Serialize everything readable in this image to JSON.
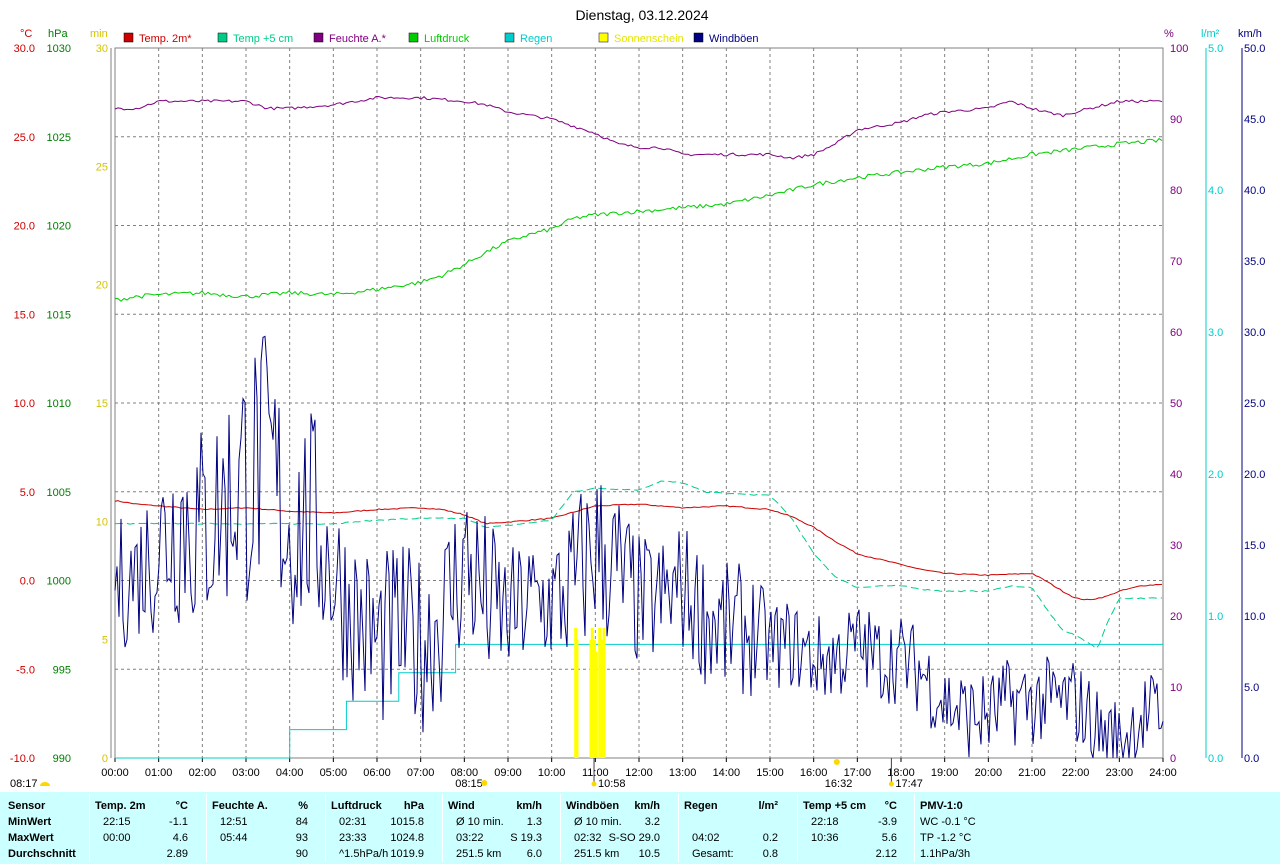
{
  "chart_data": {
    "type": "line",
    "title": "Dienstag, 03.12.2024",
    "x_ticks": [
      "00:00",
      "01:00",
      "02:00",
      "03:00",
      "04:00",
      "05:00",
      "06:00",
      "07:00",
      "08:00",
      "09:00",
      "10:00",
      "11:00",
      "12:00",
      "13:00",
      "14:00",
      "15:00",
      "16:00",
      "17:00",
      "18:00",
      "19:00",
      "20:00",
      "21:00",
      "22:00",
      "23:00",
      "24:00"
    ],
    "x_range_hours": [
      0,
      24
    ],
    "grid": true,
    "legend_position": "top",
    "axes": {
      "temp": {
        "unit": "°C",
        "range": [
          -10,
          30
        ],
        "ticks": [
          "-10.0",
          "-5.0",
          "0.0",
          "5.0",
          "10.0",
          "15.0",
          "20.0",
          "25.0",
          "30.0"
        ],
        "color": "#cc0000"
      },
      "pressure": {
        "unit": "hPa",
        "range": [
          990,
          1030
        ],
        "ticks": [
          "990",
          "995",
          "1000",
          "1005",
          "1010",
          "1015",
          "1020",
          "1025",
          "1030"
        ],
        "color": "#008000"
      },
      "sun": {
        "unit": "min",
        "range": [
          0,
          30
        ],
        "ticks": [
          "0",
          "5",
          "10",
          "15",
          "20",
          "25",
          "30"
        ],
        "color": "#e6e600"
      },
      "humidity": {
        "unit": "%",
        "range": [
          0,
          100
        ],
        "ticks": [
          "0",
          "10",
          "20",
          "30",
          "40",
          "50",
          "60",
          "70",
          "80",
          "90",
          "100"
        ],
        "color": "#800080"
      },
      "rain": {
        "unit": "l/m²",
        "range": [
          0,
          5
        ],
        "ticks": [
          "0.0",
          "1.0",
          "2.0",
          "3.0",
          "4.0",
          "5.0"
        ],
        "color": "#00cccc"
      },
      "wind": {
        "unit": "km/h",
        "range": [
          0,
          50
        ],
        "ticks": [
          "0.0",
          "5.0",
          "10.0",
          "15.0",
          "20.0",
          "25.0",
          "30.0",
          "35.0",
          "40.0",
          "45.0",
          "50.0"
        ],
        "color": "#000080"
      }
    },
    "series": [
      {
        "name": "Temp. 2m*",
        "axis": "temp",
        "color": "#cc0000",
        "style": "solid",
        "x": [
          0,
          0.5,
          1,
          2,
          3,
          4,
          5,
          6,
          7,
          7.5,
          8,
          8.5,
          9,
          10,
          11,
          12,
          13,
          14,
          15,
          15.5,
          16,
          16.5,
          17,
          17.5,
          18,
          18.5,
          19,
          20,
          21,
          21.3,
          21.7,
          22,
          22.3,
          22.7,
          23,
          23.5,
          24
        ],
        "y": [
          4.5,
          4.3,
          4.2,
          4.0,
          4.1,
          3.9,
          3.8,
          4.0,
          4.1,
          4.0,
          3.7,
          3.2,
          3.3,
          3.5,
          4.2,
          4.3,
          4.1,
          4.2,
          4.0,
          3.6,
          3.0,
          2.2,
          1.5,
          1.2,
          0.9,
          0.6,
          0.4,
          0.3,
          0.4,
          0.0,
          -0.6,
          -1.0,
          -1.1,
          -0.9,
          -0.6,
          -0.3,
          -0.2
        ]
      },
      {
        "name": "Temp +5 cm",
        "axis": "temp",
        "color": "#00cc88",
        "style": "dashed",
        "x": [
          0,
          1,
          2,
          3,
          4,
          5,
          6,
          7,
          8,
          8.5,
          9,
          10,
          10.5,
          11,
          12,
          12.5,
          13,
          13.5,
          14,
          15,
          15.5,
          16,
          16.5,
          17,
          17.5,
          18,
          18.5,
          19,
          20,
          20.5,
          21,
          21.3,
          21.7,
          22,
          22.3,
          22.5,
          22.7,
          23,
          24
        ],
        "y": [
          3.2,
          3.2,
          3.2,
          3.2,
          3.2,
          3.2,
          3.4,
          3.5,
          3.5,
          3.0,
          3.1,
          3.4,
          5.0,
          5.2,
          5.1,
          5.6,
          5.5,
          5.0,
          4.9,
          4.8,
          3.5,
          1.5,
          0.2,
          -0.4,
          -0.3,
          -0.3,
          -0.5,
          -0.6,
          -0.6,
          -0.3,
          -0.4,
          -1.5,
          -2.8,
          -3.1,
          -3.5,
          -3.9,
          -2.5,
          -1.0,
          -1.0
        ]
      },
      {
        "name": "Feuchte A.*",
        "axis": "humidity",
        "color": "#800080",
        "style": "solid",
        "x": [
          0,
          0.5,
          1,
          2,
          3,
          3.5,
          4,
          5,
          6,
          7,
          8,
          8.5,
          9,
          10,
          11,
          11.5,
          12,
          12.5,
          13,
          14,
          15,
          15.5,
          16,
          16.5,
          17,
          17.5,
          18,
          18.5,
          19,
          20,
          20.5,
          21,
          21.3,
          21.7,
          22,
          23,
          24
        ],
        "y": [
          91.5,
          91.5,
          92.5,
          92.5,
          92.5,
          91.5,
          91.5,
          92.0,
          93.0,
          93.0,
          92.5,
          92.0,
          91.0,
          90.0,
          88.0,
          86.5,
          86.0,
          86.0,
          85.0,
          85.0,
          85.0,
          84.5,
          85.0,
          86.5,
          88.5,
          89.0,
          89.5,
          90.5,
          91.0,
          91.5,
          92.5,
          91.5,
          91.0,
          90.5,
          91.0,
          92.5,
          92.5
        ]
      },
      {
        "name": "Luftdruck",
        "axis": "pressure",
        "color": "#00cc00",
        "style": "solid",
        "x": [
          0,
          0.5,
          1,
          2,
          3,
          4,
          5,
          6,
          7,
          7.5,
          8,
          8.5,
          9,
          9.5,
          10,
          10.5,
          11,
          12,
          13,
          14,
          15,
          16,
          17,
          18,
          19,
          20,
          21,
          22,
          23,
          24
        ],
        "y": [
          1015.8,
          1016.0,
          1016.1,
          1016.2,
          1016.0,
          1016.2,
          1016.1,
          1016.4,
          1016.8,
          1017.2,
          1017.8,
          1018.5,
          1019.1,
          1019.5,
          1019.8,
          1020.4,
          1020.6,
          1020.8,
          1021.0,
          1021.2,
          1021.7,
          1022.3,
          1022.7,
          1023.0,
          1023.3,
          1023.5,
          1024.0,
          1024.3,
          1024.6,
          1024.8
        ]
      },
      {
        "name": "Regen",
        "axis": "rain",
        "color": "#00cccc",
        "style": "step",
        "x": [
          0,
          4.0,
          4.0,
          5.3,
          5.3,
          6.5,
          6.5,
          7.8,
          7.8,
          24
        ],
        "y": [
          0,
          0,
          0.2,
          0.2,
          0.4,
          0.4,
          0.6,
          0.6,
          0.8,
          0.8
        ]
      },
      {
        "name": "Sonnenschein",
        "axis": "sun",
        "color": "#ffff00",
        "style": "bars",
        "x": [
          10.55,
          10.58,
          10.9,
          10.93,
          10.98,
          11.02,
          11.1,
          11.15,
          11.2
        ],
        "y": [
          5.5,
          5.0,
          5.0,
          5.5,
          5.0,
          4.5,
          5.5,
          5.0,
          5.5
        ]
      },
      {
        "name": "Windböen",
        "axis": "wind",
        "color": "#000080",
        "style": "noisy",
        "x": [
          0,
          0.5,
          1,
          1.5,
          2,
          2.5,
          3,
          3.5,
          4,
          4.5,
          5,
          5.5,
          6,
          6.5,
          7,
          7.5,
          8,
          8.5,
          9,
          9.5,
          10,
          10.5,
          11,
          11.5,
          12,
          12.5,
          13,
          13.5,
          14,
          14.5,
          15,
          15.5,
          16,
          16.5,
          17,
          17.5,
          18,
          18.5,
          19,
          19.5,
          20,
          20.5,
          21,
          21.5,
          22,
          22.5,
          23,
          23.5,
          24
        ],
        "y": [
          12,
          13,
          15,
          17,
          16,
          18,
          20,
          21,
          16,
          17,
          13,
          10,
          8,
          9,
          8,
          10,
          14,
          11,
          10,
          11,
          11,
          12,
          15,
          13,
          11,
          11,
          12,
          10,
          9,
          9,
          8,
          8,
          7,
          7,
          8,
          7,
          7,
          6,
          4,
          3,
          3,
          4,
          4,
          4,
          4,
          2,
          1,
          3,
          3
        ],
        "amplitude": [
          3,
          3,
          4,
          5,
          5,
          5,
          6,
          6,
          5,
          5,
          4,
          4,
          4,
          4,
          4,
          4,
          4,
          4,
          3,
          3,
          3,
          4,
          4,
          4,
          3,
          3,
          3,
          3,
          3,
          3,
          2,
          2,
          2,
          2,
          2,
          2,
          2,
          2,
          2,
          2,
          2,
          2,
          2,
          2,
          2,
          2,
          2,
          2,
          2
        ]
      }
    ],
    "annotations": [
      {
        "label": "08:17",
        "axis_pos": "left-bottom"
      },
      {
        "label": "08:15",
        "hour": 8.25
      },
      {
        "label": "10:58",
        "hour": 10.97
      },
      {
        "label": "16:32",
        "hour": 16.53
      },
      {
        "label": "17:47",
        "hour": 17.78
      }
    ]
  },
  "summary": {
    "columns": [
      {
        "key": "sensor",
        "header": "Sensor",
        "unit": ""
      },
      {
        "key": "temp2m",
        "header": "Temp. 2m",
        "unit": "°C"
      },
      {
        "key": "feuchte",
        "header": "Feuchte A.",
        "unit": "%"
      },
      {
        "key": "luftdruck",
        "header": "Luftdruck",
        "unit": "hPa"
      },
      {
        "key": "wind",
        "header": "Wind",
        "unit": "km/h"
      },
      {
        "key": "windboeen",
        "header": "Windböen",
        "unit": "km/h"
      },
      {
        "key": "regen",
        "header": "Regen",
        "unit": "l/m²"
      },
      {
        "key": "temp5cm",
        "header": "Temp +5 cm",
        "unit": "°C"
      },
      {
        "key": "pmv",
        "header": "PMV-1:0",
        "unit": ""
      }
    ],
    "row_labels": [
      "MinWert",
      "MaxWert",
      "Durchschnitt"
    ],
    "temp2m": [
      [
        "22:15",
        "-1.1"
      ],
      [
        "00:00",
        "4.6"
      ],
      [
        "",
        "2.89"
      ]
    ],
    "feuchte": [
      [
        "12:51",
        "84"
      ],
      [
        "05:44",
        "93"
      ],
      [
        "",
        "90"
      ]
    ],
    "luftdruck": [
      [
        "02:31",
        "1015.8"
      ],
      [
        "23:33",
        "1024.8"
      ],
      [
        "^1.5hPa/h",
        "1019.9"
      ]
    ],
    "wind": [
      [
        "Ø 10 min.",
        "1.3"
      ],
      [
        "03:22",
        "S 19.3"
      ],
      [
        "251.5 km",
        "6.0"
      ]
    ],
    "windboeen": [
      [
        "Ø 10 min.",
        "3.2"
      ],
      [
        "02:32",
        "S-SO 29.0"
      ],
      [
        "251.5 km",
        "10.5"
      ]
    ],
    "regen": [
      [
        "",
        ""
      ],
      [
        "04:02",
        "0.2"
      ],
      [
        "Gesamt:",
        "0.8"
      ]
    ],
    "temp5cm": [
      [
        "22:18",
        "-3.9"
      ],
      [
        "10:36",
        "5.6"
      ],
      [
        "",
        "2.12"
      ]
    ],
    "pmv": [
      "WC -0.1 °C",
      "TP -1.2 °C",
      "1.1hPa/3h"
    ]
  }
}
